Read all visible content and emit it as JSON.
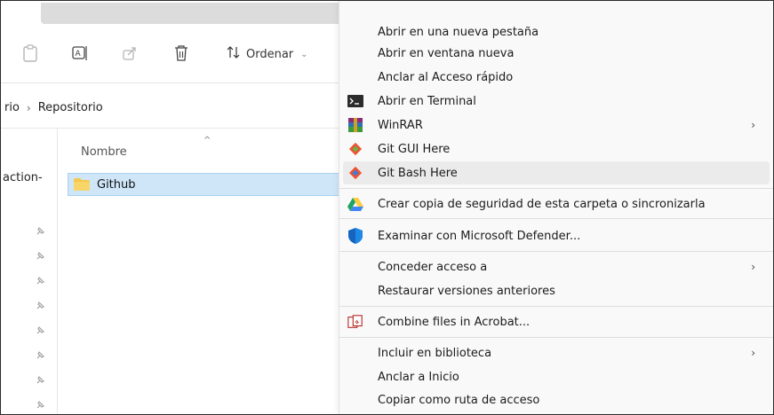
{
  "explorer": {
    "toolbar": {
      "sort_label": "Ordenar",
      "sort_chevron": "⌄"
    },
    "breadcrumb": {
      "parent": "rio",
      "separator": "›",
      "current": "Repositorio"
    },
    "nav_label": "action-",
    "column_header": "Nombre",
    "sort_caret": "^",
    "selected_item": "Github"
  },
  "menu": {
    "items": [
      {
        "label": "Abrir en una nueva pestaña"
      },
      {
        "label": "Abrir en ventana nueva"
      },
      {
        "label": "Anclar al Acceso rápido"
      },
      {
        "label": "Abrir en Terminal"
      },
      {
        "label": "WinRAR",
        "arrow": "›"
      },
      {
        "label": "Git GUI Here"
      },
      {
        "label": "Git Bash Here"
      },
      {
        "label": "Crear copia de seguridad de esta carpeta o sincronizarla"
      },
      {
        "label": "Examinar con Microsoft Defender..."
      },
      {
        "label": "Conceder acceso a",
        "arrow": "›"
      },
      {
        "label": "Restaurar versiones anteriores"
      },
      {
        "label": "Combine files in Acrobat..."
      },
      {
        "label": "Incluir en biblioteca",
        "arrow": "›"
      },
      {
        "label": "Anclar a Inicio"
      },
      {
        "label": "Copiar como ruta de acceso"
      }
    ]
  },
  "colors": {
    "selection": "#cfe6f8",
    "hover": "#ebebeb",
    "folder": "#f3c84b",
    "drive_green": "#1fa463",
    "drive_yellow": "#ffcd40",
    "drive_blue": "#4285f4",
    "git": "#f05033",
    "defender": "#1565c0"
  }
}
